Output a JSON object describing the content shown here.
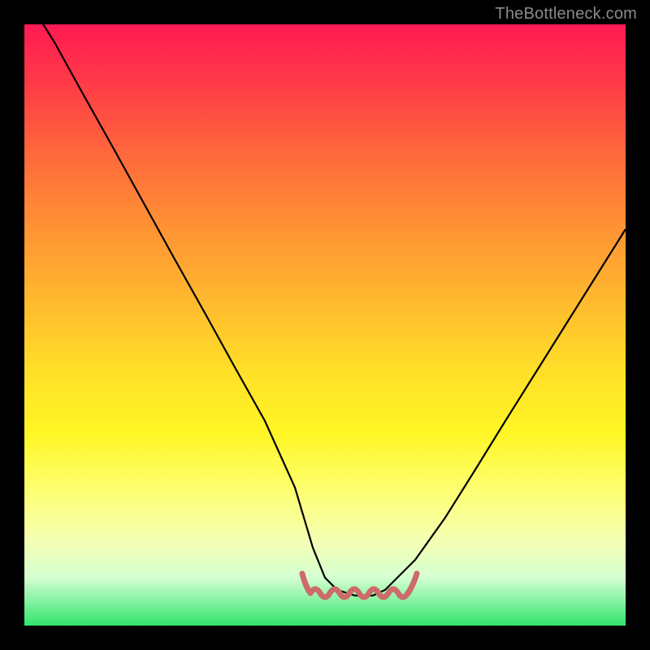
{
  "watermark": {
    "text": "TheBottleneck.com"
  },
  "chart_data": {
    "type": "line",
    "title": "",
    "xlabel": "",
    "ylabel": "",
    "xlim": [
      0,
      100
    ],
    "ylim": [
      0,
      100
    ],
    "grid": false,
    "legend": false,
    "series": [
      {
        "name": "bottleneck-curve",
        "x": [
          0,
          5,
          10,
          15,
          20,
          25,
          30,
          35,
          40,
          45,
          48,
          50,
          52,
          55,
          58,
          60,
          62,
          65,
          70,
          75,
          80,
          85,
          90,
          95,
          100
        ],
        "values": [
          105,
          97,
          88,
          79,
          70,
          61,
          52,
          43,
          34,
          23,
          13,
          8,
          6,
          5,
          5,
          6,
          8,
          11,
          18,
          26,
          34,
          42,
          50,
          58,
          66
        ],
        "color": "#000000"
      }
    ],
    "annotations": [
      {
        "name": "flat-region-marker",
        "x_range": [
          48,
          63
        ],
        "y": 5,
        "color": "#cd6a6a"
      }
    ],
    "background_gradient": {
      "type": "vertical",
      "stops": [
        {
          "pos": 0.0,
          "color": "#ff1a54"
        },
        {
          "pos": 0.5,
          "color": "#ffcf2b"
        },
        {
          "pos": 0.78,
          "color": "#fdff75"
        },
        {
          "pos": 1.0,
          "color": "#31e46f"
        }
      ]
    }
  }
}
